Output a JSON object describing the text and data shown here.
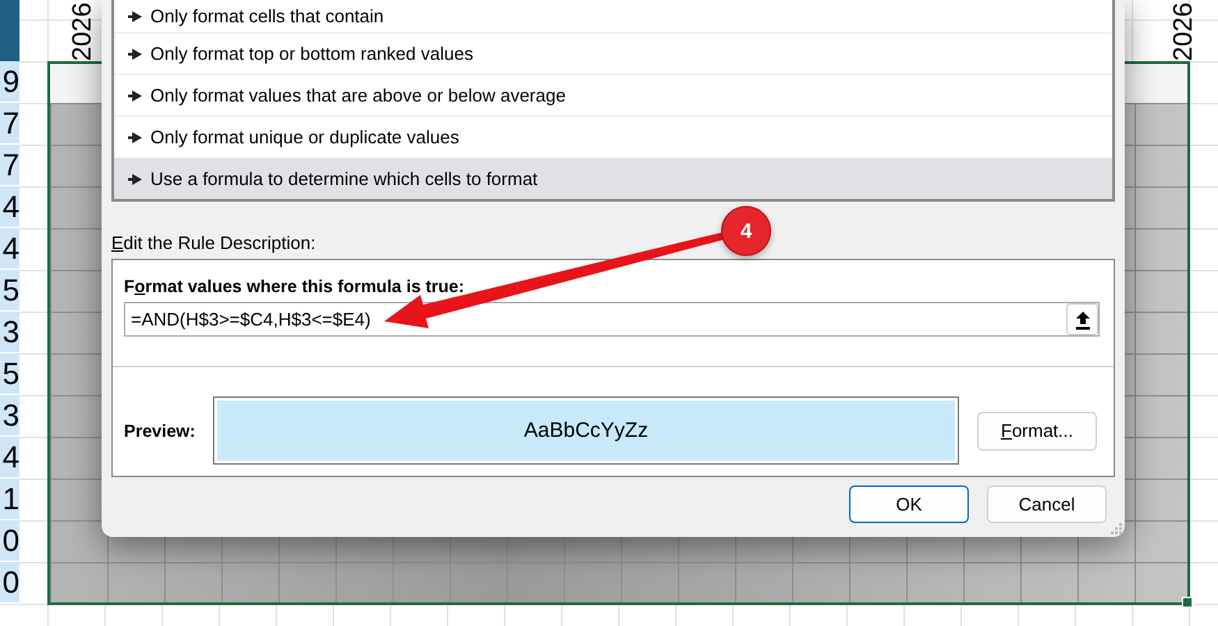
{
  "sheet": {
    "column_headers": [
      "2026",
      "2026"
    ],
    "row_values": [
      "9",
      "7",
      "7",
      "4",
      "4",
      "5",
      "3",
      "5",
      "3",
      "4",
      "1",
      "0",
      "0"
    ]
  },
  "dialog": {
    "rule_types": [
      {
        "label": "Only format cells that contain",
        "selected": false
      },
      {
        "label": "Only format top or bottom ranked values",
        "selected": false
      },
      {
        "label": "Only format values that are above or below average",
        "selected": false
      },
      {
        "label": "Only format unique or duplicate values",
        "selected": false
      },
      {
        "label": "Use a formula to determine which cells to format",
        "selected": true
      }
    ],
    "description_heading": {
      "access_key": "E",
      "after_key": "dit the Rule Description:"
    },
    "formula_label": {
      "before_key": "F",
      "access_key": "o",
      "after_key": "rmat values where this formula is true:"
    },
    "formula_value": "=AND(H$3>=$C4,H$3<=$E4)",
    "preview_label": "Preview:",
    "preview_sample": "AaBbCcYyZz",
    "format_button": {
      "access_key": "F",
      "after_key": "ormat..."
    },
    "buttons": [
      {
        "label": "OK",
        "default": true
      },
      {
        "label": "Cancel",
        "default": false
      }
    ]
  },
  "callout": {
    "number": "4"
  }
}
